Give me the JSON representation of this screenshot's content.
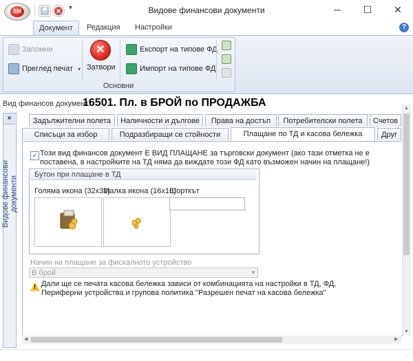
{
  "window": {
    "title": "Видове финансови документи",
    "logo_text": "SM"
  },
  "ribbon": {
    "tabs": [
      {
        "label": "Документ"
      },
      {
        "label": "Редакция"
      },
      {
        "label": "Настройки"
      }
    ],
    "group_label": "Основни",
    "buttons": {
      "save": "Запомни",
      "preview_print": "Преглед печат",
      "close": "Затвори",
      "export": "Експорт на типове ФД",
      "import": "Импорт на типове ФД"
    }
  },
  "document": {
    "label": "Вид финансов документ:",
    "title": "16501. Пл. в БРОЙ по ПРОДАЖБА"
  },
  "sidebar": {
    "expand": "»",
    "label": "Видове финансови документи"
  },
  "tabs_row1": [
    {
      "label": "Задължителни полета"
    },
    {
      "label": "Наличности и дългове"
    },
    {
      "label": "Права на достъп"
    },
    {
      "label": "Потребителски полета"
    },
    {
      "label": "Счетов"
    }
  ],
  "tabs_row2": [
    {
      "label": "Списъци за избор"
    },
    {
      "label": "Подразбиращи се стойности"
    },
    {
      "label": "Плащане по ТД и касова бележка"
    },
    {
      "label": "Друг"
    }
  ],
  "payment_tab": {
    "checkbox_checked": true,
    "checkbox_text": "Този вид финансов документ Е ВИД ПЛАЩАНЕ за търговски документ (ако тази отметка не е поставена, в настройките на ТД няма да виждате този ФД като възможен начин на плащане!)",
    "button_group_title": "Бутон при плащане в ТД",
    "large_icon_label": "Голяма икона (32x32)",
    "small_icon_label": "Малка икона (16x16)",
    "shortcut_label": "Шорткът",
    "shortcut_value": "",
    "fiscal_label": "Начин на плащане за фискалното устройство",
    "fiscal_value": "В брой",
    "warning_text": "Дали ще се печата касова бележка зависи от комбинацията на настройки в ТД, ФД, Периферни устройства и групова политика \"Разрешен печат на касова бележка\""
  },
  "colors": {
    "accent": "#3c7ad6",
    "ribbon_bg": "#e4ebf5",
    "warning": "#f0c020"
  }
}
